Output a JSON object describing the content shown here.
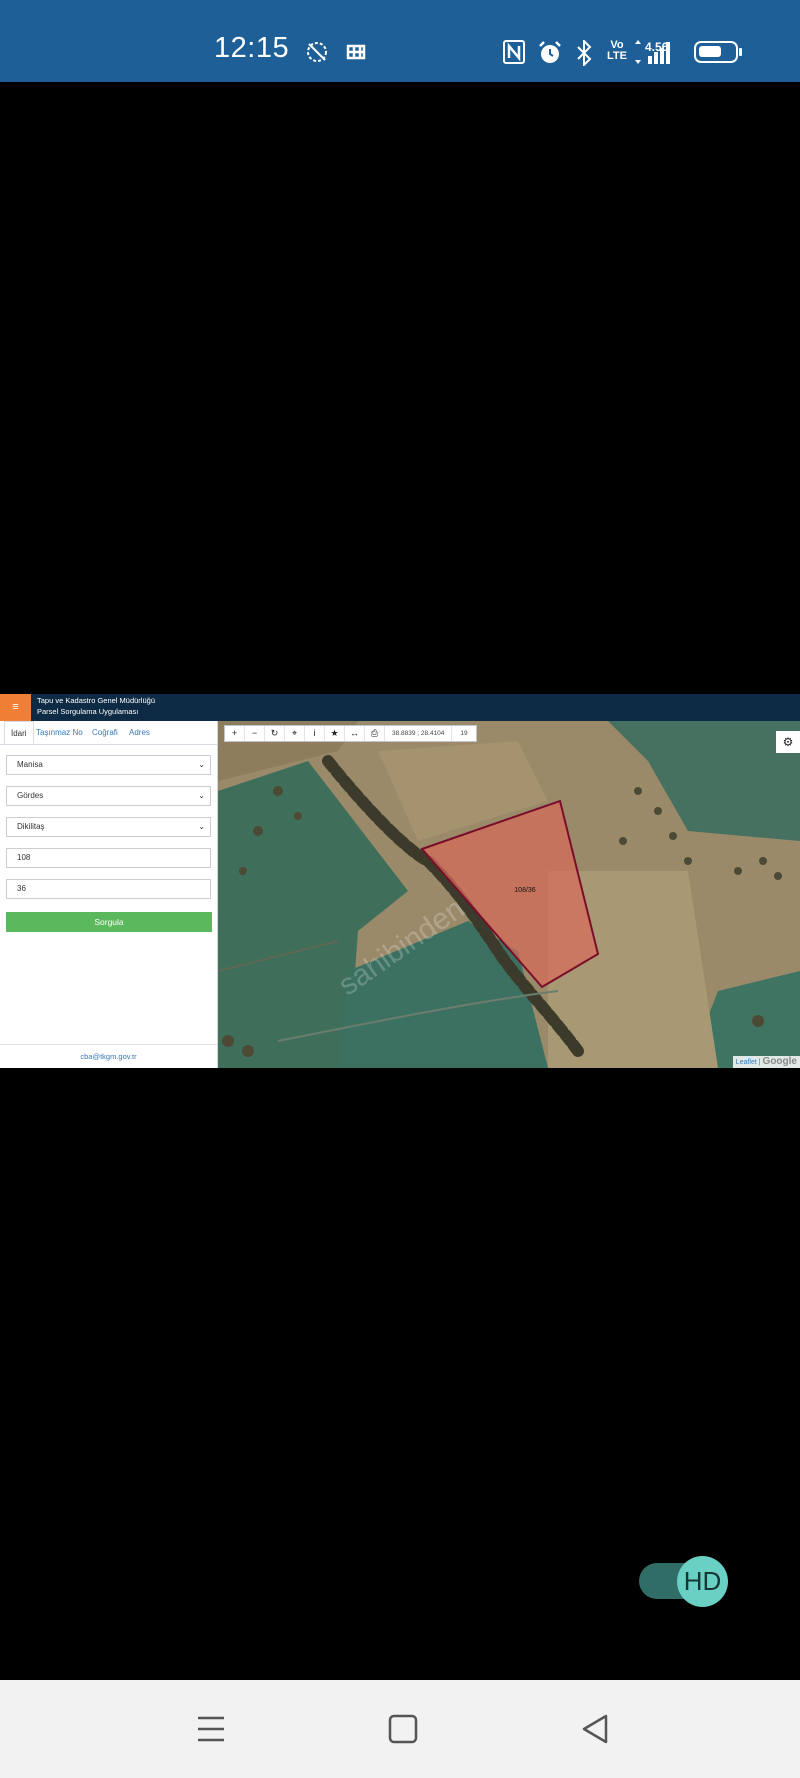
{
  "status_bar": {
    "time": "12:15",
    "network_speed": "4.56",
    "volte_top": "Vo",
    "volte_bottom": "LTE",
    "icons": [
      "no-sound-icon",
      "b-app-icon",
      "nfc-icon",
      "alarm-icon",
      "bluetooth-icon",
      "volte-icon",
      "signal-icon",
      "battery-icon"
    ]
  },
  "app": {
    "header": {
      "menu_icon": "≡",
      "line1": "Tapu ve Kadastro Genel Müdürlüğü",
      "line2": "Parsel Sorgulama Uygulaması"
    },
    "tabs": [
      {
        "label": "İdari",
        "active": true
      },
      {
        "label": "Taşınmaz No",
        "active": false
      },
      {
        "label": "Coğrafi",
        "active": false
      },
      {
        "label": "Adres",
        "active": false
      }
    ],
    "form": {
      "province": "Manisa",
      "district": "Gördes",
      "neighborhood": "Dikilitaş",
      "block_no": "108",
      "parcel_no": "36",
      "query_button": "Sorgula"
    },
    "footer_email": "cba@tkgm.gov.tr",
    "map": {
      "coordinates": "38.8839 ; 28.4104",
      "zoom_level": "19",
      "parcel_label": "108/36",
      "watermark": "sahibinden",
      "attribution_leaflet": "Leaflet",
      "attribution_google": "Google",
      "toolbar_icons": [
        "zoom-in-icon",
        "zoom-out-icon",
        "refresh-icon",
        "locate-icon",
        "info-icon",
        "star-icon",
        "measure-icon",
        "print-icon"
      ]
    }
  },
  "hd_toggle": {
    "label": "HD",
    "on": true
  },
  "nav_bar": {
    "icons": [
      "menu-icon",
      "home-icon",
      "back-icon"
    ]
  }
}
